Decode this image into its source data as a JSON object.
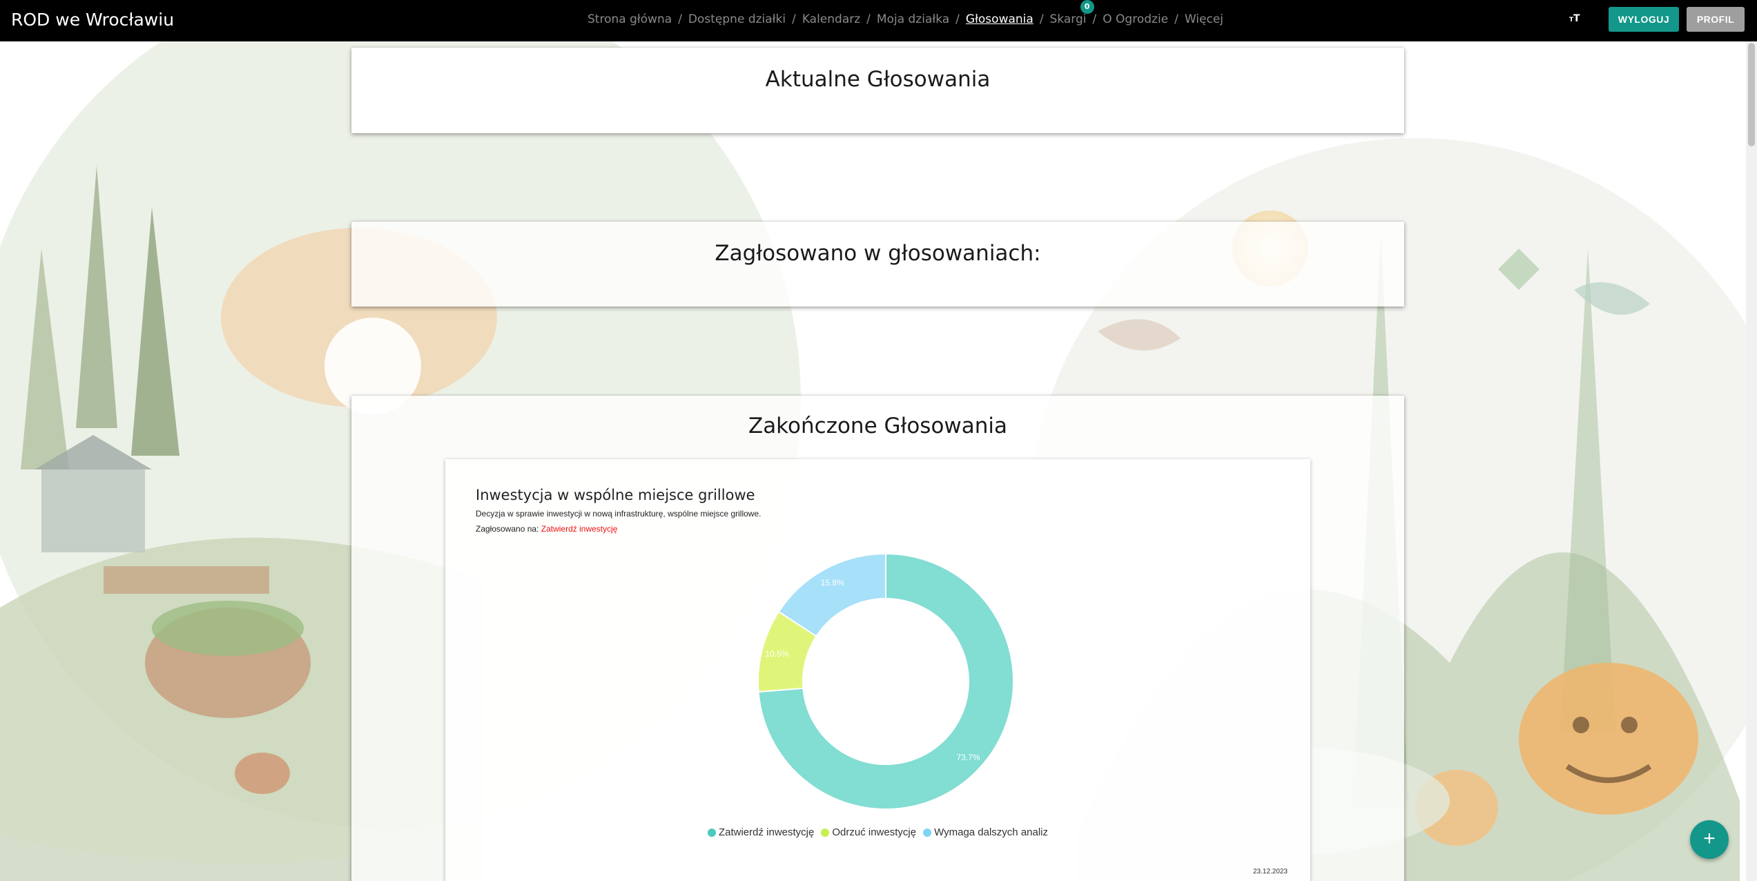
{
  "navbar": {
    "brand": "ROD we Wrocławiu",
    "links": [
      {
        "label": "Strona główna"
      },
      {
        "label": "Dostępne działki"
      },
      {
        "label": "Kalendarz"
      },
      {
        "label": "Moja działka"
      },
      {
        "label": "Głosowania",
        "active": true
      },
      {
        "label": "Skargi",
        "badge": "0"
      },
      {
        "label": "O Ogrodzie"
      },
      {
        "label": "Więcej"
      }
    ],
    "separator": "/",
    "text_size_icon": "text-size-icon",
    "logout_label": "WYLOGUJ",
    "profile_label": "PROFIL"
  },
  "sections": {
    "current_title": "Aktualne Głosowania",
    "voted_title": "Zagłosowano w głosowaniach:",
    "finished_title": "Zakończone Głosowania"
  },
  "vote": {
    "title": "Inwestycja w wspólne miejsce grillowe",
    "description": "Decyzja w sprawie inwestycji w nową infrastrukturę, wspólne miejsce grillowe.",
    "voted_on_label": "Zagłosowano na:",
    "voted_on_value": "Zatwierdź inwestycję",
    "date": "23.12.2023"
  },
  "chart_data": {
    "type": "pie",
    "variant": "doughnut",
    "categories": [
      "Zatwierdź inwestycję",
      "Odrzuć inwestycję",
      "Wymaga dalszych analiz"
    ],
    "values": [
      73.7,
      10.5,
      15.8
    ],
    "labels": [
      "73.7%",
      "10.5%",
      "15.8%"
    ],
    "colors": [
      "#82ddd3",
      "#dff57a",
      "#a6e0f9"
    ],
    "legend_colors": [
      "#4dc9bd",
      "#c8ef52",
      "#7fd3f6"
    ],
    "legend_position": "bottom"
  },
  "fab_icon": "plus-icon",
  "colors": {
    "accent": "#13978a",
    "navbar": "#000000",
    "profile": "#9e9e9e"
  }
}
